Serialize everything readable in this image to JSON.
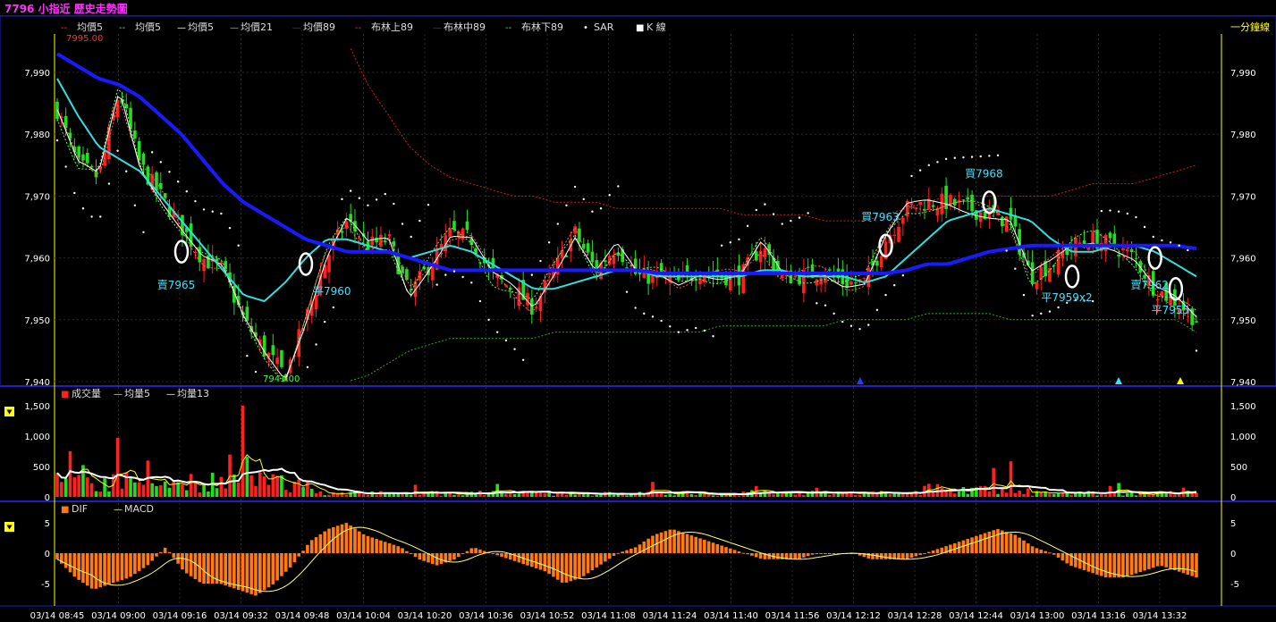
{
  "title": "7796 小指近  歷史走勢圖",
  "colors": {
    "up": "#ff2020",
    "down": "#20e020",
    "axis": "#ffff00",
    "grid": "#2a2a2a",
    "ma21": "#30e0e0",
    "ma89": "#1a1aff",
    "boll": "#d02020",
    "bolllow": "#20b020",
    "sar": "#ffffff",
    "panel_border": "#2020c0",
    "annotation": "#40e0ff",
    "dif": "#ff7a10",
    "macd": "#ffff80"
  },
  "legend_main": [
    {
      "marker": "--",
      "label": "均價5",
      "color": "#ff4040"
    },
    {
      "marker": "--",
      "label": "均價5",
      "color": "#40ff40"
    },
    {
      "marker": "—",
      "label": "均價5",
      "color": "#ffffff"
    },
    {
      "marker": "—",
      "label": "均價21",
      "color": "#30e0e0"
    },
    {
      "marker": "—",
      "label": "均價89",
      "color": "#3030ff"
    },
    {
      "marker": "--",
      "label": "布林上89",
      "color": "#ff3030"
    },
    {
      "marker": "—",
      "label": "布林中89",
      "color": "#3030ff"
    },
    {
      "marker": "--",
      "label": "布林下89",
      "color": "#30ff30"
    },
    {
      "marker": "•",
      "label": "SAR",
      "color": "#ffffff"
    },
    {
      "marker": "■",
      "label": "K 線",
      "color": "#ffffff"
    }
  ],
  "period_label": "一分鐘線",
  "legend_volume": [
    {
      "marker": "■",
      "label": "成交量",
      "color": "#ff2020"
    },
    {
      "marker": "—",
      "label": "均量5",
      "color": "#ffff00"
    },
    {
      "marker": "—",
      "label": "均量13",
      "color": "#ffffff"
    }
  ],
  "legend_macd": [
    {
      "marker": "■",
      "label": "DIF",
      "color": "#ff7a10"
    },
    {
      "marker": "—",
      "label": "MACD",
      "color": "#ffff80"
    }
  ],
  "chart_data": {
    "type": "candlestick",
    "y_ticks": [
      "7,940",
      "7,950",
      "7,960",
      "7,970",
      "7,980",
      "7,990"
    ],
    "y_tick_values": [
      7940,
      7950,
      7960,
      7970,
      7980,
      7990
    ],
    "ylim": [
      7940,
      7995
    ],
    "high_label": "7995.00",
    "low_label": "7941.00",
    "x_labels": [
      "03/14 08:45",
      "03/14 09:00",
      "03/14 09:16",
      "03/14 09:32",
      "03/14 09:48",
      "03/14 10:04",
      "03/14 10:20",
      "03/14 10:36",
      "03/14 10:52",
      "03/14 11:08",
      "03/14 11:24",
      "03/14 11:40",
      "03/14 11:56",
      "03/14 12:12",
      "03/14 12:28",
      "03/14 12:44",
      "03/14 13:00",
      "03/14 13:16",
      "03/14 13:32"
    ],
    "close_path": [
      7984,
      7975,
      7973,
      7987,
      7975,
      7970,
      7965,
      7960,
      7958,
      7950,
      7945,
      7941,
      7950,
      7960,
      7966,
      7962,
      7963,
      7954,
      7959,
      7964,
      7963,
      7957,
      7955,
      7952,
      7958,
      7964,
      7958,
      7962,
      7957,
      7957,
      7956,
      7958,
      7957,
      7957,
      7962,
      7957,
      7957,
      7958,
      7956,
      7956,
      7963,
      7968,
      7969,
      7969,
      7968,
      7967,
      7966,
      7957,
      7959,
      7962,
      7963,
      7962,
      7960,
      7955,
      7953,
      7950
    ],
    "ma21_path": [
      7989,
      7983,
      7978,
      7976,
      7974,
      7970,
      7966,
      7962,
      7958,
      7954,
      7953,
      7956,
      7960,
      7963,
      7963,
      7962,
      7961,
      7960,
      7961,
      7962,
      7961,
      7959,
      7957,
      7955,
      7955,
      7956,
      7957,
      7958,
      7958,
      7957,
      7957,
      7957,
      7957,
      7957,
      7958,
      7958,
      7957,
      7957,
      7957,
      7956,
      7957,
      7960,
      7963,
      7966,
      7967,
      7968,
      7967,
      7966,
      7963,
      7961,
      7961,
      7962,
      7962,
      7961,
      7959,
      7957
    ],
    "ma89_path": [
      7993,
      7991,
      7989,
      7988,
      7986,
      7983,
      7980,
      7976,
      7972,
      7969,
      7967,
      7965,
      7963,
      7962,
      7961,
      7961,
      7961,
      7960,
      7959,
      7958,
      7958,
      7958,
      7958,
      7958,
      7958,
      7958,
      7958,
      7958,
      7958,
      7957.5,
      7957.5,
      7957.5,
      7957.5,
      7957.5,
      7957.5,
      7957.5,
      7957.5,
      7957.5,
      7957.5,
      7957.5,
      7957.5,
      7958,
      7959,
      7959,
      7960,
      7961,
      7961.5,
      7962,
      7962,
      7962,
      7962,
      7962,
      7962,
      7962,
      7962,
      7961.5
    ],
    "boll_upper_path": [
      null,
      null,
      null,
      null,
      null,
      null,
      null,
      null,
      null,
      null,
      null,
      null,
      null,
      null,
      7995,
      7988,
      7983,
      7978,
      7975,
      7973,
      7972,
      7971,
      7970,
      7970,
      7969,
      7969,
      7969,
      7968,
      7968,
      7968,
      7968,
      7968,
      7968,
      7967,
      7967,
      7967,
      7967,
      7966,
      7966,
      7966,
      7967,
      7968,
      7969,
      7970,
      7970,
      7970,
      7970,
      7970,
      7970,
      7971,
      7972,
      7972,
      7972,
      7973,
      7974,
      7975
    ],
    "boll_lower_path": [
      null,
      null,
      null,
      null,
      null,
      null,
      null,
      null,
      null,
      null,
      null,
      null,
      null,
      null,
      7940,
      7941,
      7943,
      7945,
      7946,
      7947,
      7947,
      7947,
      7947,
      7947,
      7948,
      7948,
      7948,
      7948,
      7948,
      7948,
      7948,
      7948,
      7949,
      7949,
      7949,
      7949,
      7949,
      7949,
      7950,
      7950,
      7950,
      7950,
      7951,
      7951,
      7951,
      7951,
      7950,
      7950,
      7950,
      7950,
      7950,
      7950,
      7950,
      7950,
      7950,
      7948
    ],
    "annotations": [
      {
        "text": "賣7965",
        "idx": 6,
        "price": 7961,
        "label_price": 7955,
        "label_side": "left"
      },
      {
        "text": "平7960",
        "idx": 12,
        "price": 7959,
        "label_price": 7954,
        "label_side": "right"
      },
      {
        "text": "買7963",
        "idx": 40,
        "price": 7962,
        "label_price": 7966,
        "label_side": "left"
      },
      {
        "text": "買7968",
        "idx": 45,
        "price": 7969,
        "label_price": 7973,
        "label_side": "left"
      },
      {
        "text": "平7959x2",
        "idx": 49,
        "price": 7957,
        "label_price": 7953,
        "label_side": "left"
      },
      {
        "text": "賣7962",
        "idx": 53,
        "price": 7960,
        "label_price": 7955,
        "label_side": "left"
      },
      {
        "text": "平7955",
        "idx": 54,
        "price": 7955,
        "label_price": 7951,
        "label_side": "left"
      }
    ],
    "volume": {
      "y_ticks": [
        "1,500",
        "1,000",
        "500",
        "0"
      ],
      "y_tick_values": [
        1500,
        1000,
        500,
        0
      ],
      "ylim": [
        0,
        1500
      ],
      "peak": 1500
    },
    "macd": {
      "y_ticks": [
        "5",
        "0",
        "-5"
      ],
      "y_tick_values": [
        5,
        0,
        -5
      ],
      "ylim": [
        -7.5,
        5.5
      ],
      "dif_path": [
        -1,
        -4,
        -6,
        -5,
        -4,
        -2,
        1,
        -3,
        -5,
        -5,
        -6,
        -7,
        -5,
        -2,
        2,
        4,
        5,
        3,
        2,
        1,
        -1,
        -2,
        -1,
        1,
        0,
        -1,
        -2,
        -3,
        -5,
        -4,
        -2,
        0,
        1,
        3,
        4,
        3,
        2,
        1,
        0,
        -1,
        -1,
        -1,
        0,
        0,
        0,
        -1,
        -1,
        -1,
        0,
        1,
        2,
        3,
        4,
        3,
        1,
        0,
        -2,
        -3,
        -4,
        -4,
        -3,
        -2,
        -3,
        -4
      ]
    }
  }
}
